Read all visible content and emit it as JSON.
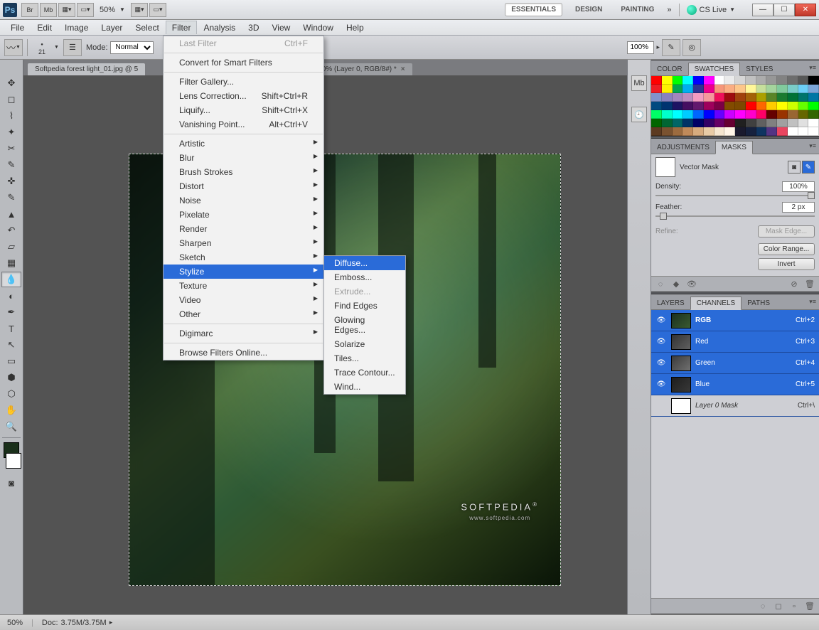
{
  "titlebar": {
    "zoom": "50%",
    "workspaces": [
      "ESSENTIALS",
      "DESIGN",
      "PAINTING"
    ],
    "cs_live": "CS Live"
  },
  "menubar": {
    "items": [
      "File",
      "Edit",
      "Image",
      "Layer",
      "Select",
      "Filter",
      "Analysis",
      "3D",
      "View",
      "Window",
      "Help"
    ]
  },
  "optionsbar": {
    "brush_size": "21",
    "mode_label": "Mode:",
    "mode_value": "Normal",
    "strength_value": "100%"
  },
  "tabs": [
    {
      "label": "Softpedia forest light_01.jpg @ 5"
    },
    {
      "label": "@ 50% (Layer 0, RGB/8#) *"
    }
  ],
  "canvas": {
    "watermark": "SOFTPEDIA",
    "watermark_sub": "www.softpedia.com"
  },
  "filter_menu": {
    "last_filter": {
      "label": "Last Filter",
      "shortcut": "Ctrl+F"
    },
    "convert": "Convert for Smart Filters",
    "gallery": "Filter Gallery...",
    "lens": {
      "label": "Lens Correction...",
      "shortcut": "Shift+Ctrl+R"
    },
    "liquify": {
      "label": "Liquify...",
      "shortcut": "Shift+Ctrl+X"
    },
    "vanishing": {
      "label": "Vanishing Point...",
      "shortcut": "Alt+Ctrl+V"
    },
    "categories": [
      "Artistic",
      "Blur",
      "Brush Strokes",
      "Distort",
      "Noise",
      "Pixelate",
      "Render",
      "Sharpen",
      "Sketch",
      "Stylize",
      "Texture",
      "Video",
      "Other"
    ],
    "digimarc": "Digimarc",
    "browse": "Browse Filters Online..."
  },
  "stylize_submenu": {
    "items": [
      "Diffuse...",
      "Emboss...",
      "Extrude...",
      "Find Edges",
      "Glowing Edges...",
      "Solarize",
      "Tiles...",
      "Trace Contour...",
      "Wind..."
    ]
  },
  "panels": {
    "color_tabs": [
      "COLOR",
      "SWATCHES",
      "STYLES"
    ],
    "adj_tabs": [
      "ADJUSTMENTS",
      "MASKS"
    ],
    "mask_label": "Vector Mask",
    "density_label": "Density:",
    "density_value": "100%",
    "feather_label": "Feather:",
    "feather_value": "2 px",
    "refine_label": "Refine:",
    "btn_mask_edge": "Mask Edge...",
    "btn_color_range": "Color Range...",
    "btn_invert": "Invert",
    "layer_tabs": [
      "LAYERS",
      "CHANNELS",
      "PATHS"
    ],
    "channels": [
      {
        "name": "RGB",
        "shortcut": "Ctrl+2"
      },
      {
        "name": "Red",
        "shortcut": "Ctrl+3"
      },
      {
        "name": "Green",
        "shortcut": "Ctrl+4"
      },
      {
        "name": "Blue",
        "shortcut": "Ctrl+5"
      },
      {
        "name": "Layer 0 Mask",
        "shortcut": "Ctrl+\\"
      }
    ]
  },
  "statusbar": {
    "zoom": "50%",
    "doc_label": "Doc:",
    "doc_value": "3.75M/3.75M"
  }
}
